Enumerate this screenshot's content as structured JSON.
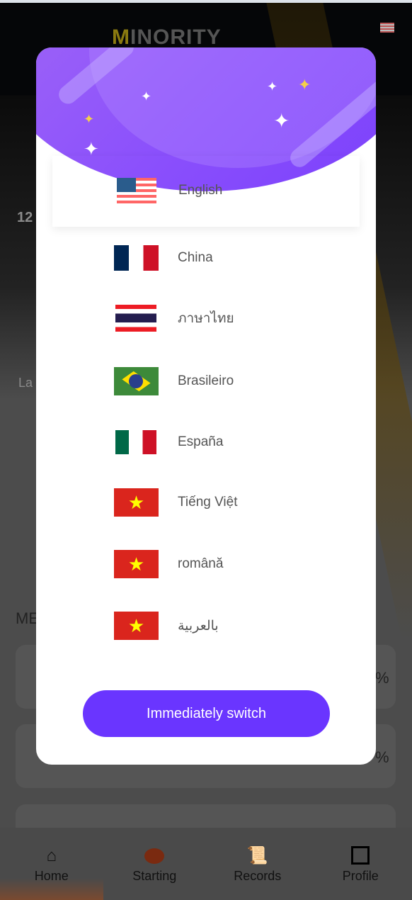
{
  "header": {
    "logo_text_m": "M",
    "logo_text_rest": "INORITY"
  },
  "background": {
    "balance_partial": "12",
    "label_partial": "La",
    "section_partial": "ME",
    "percent_partial_1": "%",
    "percent_partial_2": "%"
  },
  "language_modal": {
    "languages": [
      {
        "label": "English",
        "flag": "us",
        "selected": true
      },
      {
        "label": "China",
        "flag": "fr"
      },
      {
        "label": "ภาษาไทย",
        "flag": "th"
      },
      {
        "label": "Brasileiro",
        "flag": "br"
      },
      {
        "label": "España",
        "flag": "mx"
      },
      {
        "label": "Tiếng Việt",
        "flag": "vn"
      },
      {
        "label": "română",
        "flag": "vn"
      },
      {
        "label": "بالعربية",
        "flag": "vn"
      }
    ],
    "switch_button": "Immediately switch",
    "accent_color": "#6a35ff"
  },
  "nav": {
    "items": [
      {
        "label": "Home",
        "icon": "home-icon"
      },
      {
        "label": "Starting",
        "icon": "start-here-icon"
      },
      {
        "label": "Records",
        "icon": "scroll-icon"
      },
      {
        "label": "Profile",
        "icon": "profile-card-icon"
      }
    ]
  }
}
